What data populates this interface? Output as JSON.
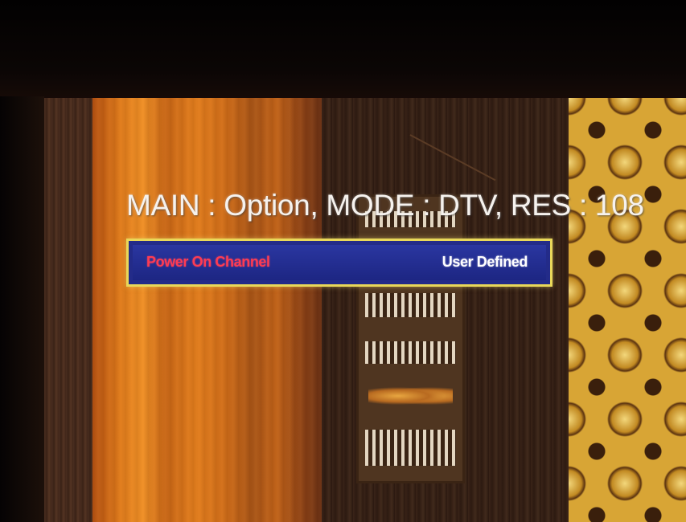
{
  "osd": {
    "status_line": "MAIN : Option, MODE : DTV, RES : 108",
    "menu_item": {
      "label": "Power On Channel",
      "value": "User Defined"
    }
  },
  "colors": {
    "menu_background": "#232b89",
    "menu_border": "#e9d85a",
    "label_color": "#ff3b52",
    "value_color": "#ffffff",
    "status_text_color": "#f6f2ee"
  }
}
